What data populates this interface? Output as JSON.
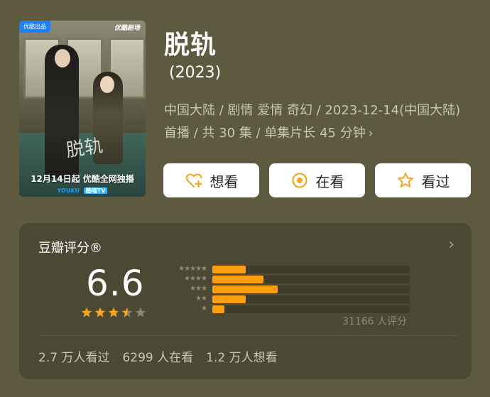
{
  "poster": {
    "badge_left": "优酷出品",
    "badge_right": "优酷剧场",
    "calligraphy": "脱轨",
    "release_text": "12月14日起 优酷全网独播",
    "logo_youku": "YOUKU",
    "logo_tv": "酷喵TV"
  },
  "title": "脱轨",
  "year": "(2023)",
  "meta": {
    "line": "中国大陆 / 剧情 爱情 奇幻 / 2023-12-14(中国大陆) 首播 / 共 30 集 / 单集片长 45 分钟",
    "chevron": "›"
  },
  "actions": {
    "want": "想看",
    "watching": "在看",
    "watched": "看过"
  },
  "rating": {
    "label": "豆瓣评分®",
    "score": "6.6",
    "stars_value": 3.5,
    "stars_max": 5,
    "distribution": [
      {
        "stars": "★★★★★",
        "fraction": 0.17
      },
      {
        "stars": "★★★★",
        "fraction": 0.26
      },
      {
        "stars": "★★★",
        "fraction": 0.33
      },
      {
        "stars": "★★",
        "fraction": 0.17
      },
      {
        "stars": "★",
        "fraction": 0.06
      }
    ],
    "count_text": "31166 人评分",
    "watched_text": "2.7 万人看过",
    "watching_text": "6299 人在看",
    "want_text": "1.2 万人想看"
  },
  "colors": {
    "background": "#5d5a3f",
    "card": "#4b4833",
    "accent": "#ff9f0f",
    "star": "#f5a623"
  }
}
